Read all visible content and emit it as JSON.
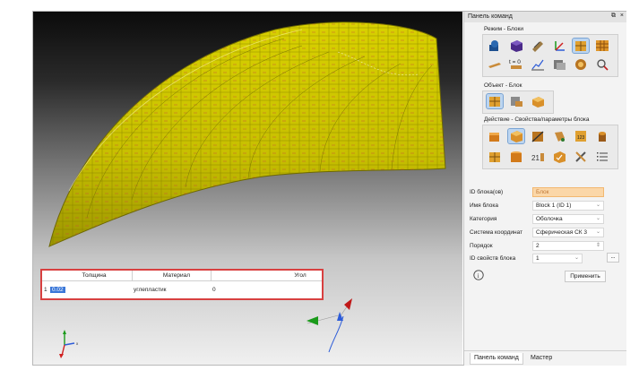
{
  "table": {
    "headers": [
      "Толщина",
      "Материал",
      "Угол"
    ],
    "rows": [
      {
        "index": "1",
        "thickness": "0.02",
        "material": "углепластик",
        "angle": "0"
      }
    ]
  },
  "panel": {
    "title": "Панель команд",
    "float_icon": "⧉",
    "close_icon": "×",
    "modes_label": "Режим - Блоки",
    "object_label": "Объект - Блок",
    "action_label": "Действие - Свойства/параметры блока",
    "mode_icons": [
      "solid-icon",
      "block-icon",
      "meshing-icon",
      "axis-icon",
      "blocks-active-icon",
      "grid-icon",
      "beam-icon",
      "time-step-icon",
      "chart-icon",
      "stack-icon",
      "gauge-icon",
      "probe-icon"
    ],
    "mode_time_label": "t = 0",
    "object_icons": [
      "block-object-icon",
      "block-list-icon",
      "block-edit-icon"
    ],
    "action_icons": [
      "cube-orange-icon",
      "cube-props-icon",
      "cut-icon",
      "paint-icon",
      "calc-icon",
      "cylinder-icon",
      "split-icon",
      "stack-blocks-icon",
      "order-icon",
      "cube-check-icon",
      "tools-icon",
      "list-icon"
    ],
    "form": {
      "block_id_label": "ID блока(ов)",
      "block_id_value": "Блок",
      "block_name_label": "Имя блока",
      "block_name_value": "Block 1 (ID 1)",
      "category_label": "Категория",
      "category_value": "Оболочка",
      "coord_label": "Система координат",
      "coord_value": "Сферическая СК 3",
      "order_label": "Порядок",
      "order_value": "2",
      "prop_id_label": "ID свойств блока",
      "prop_id_value": "1",
      "dots": "...",
      "apply": "Применить"
    },
    "tabs": [
      "Панель команд",
      "Мастер"
    ]
  },
  "colors": {
    "shell": "#cfc700",
    "shell_dark": "#8a8400",
    "panel_bg": "#f3f3f3",
    "highlight": "#fbd7a8",
    "table_border": "#d84040"
  }
}
